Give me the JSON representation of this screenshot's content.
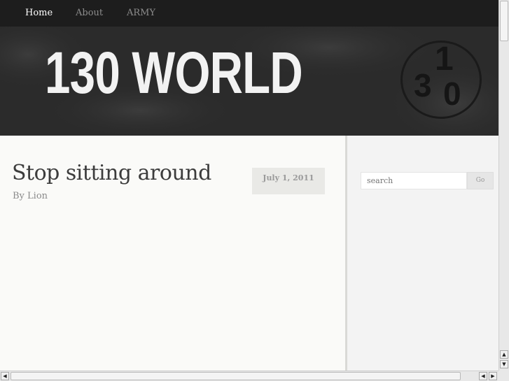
{
  "nav": {
    "items": [
      {
        "label": "Home",
        "active": true
      },
      {
        "label": "About",
        "active": false
      },
      {
        "label": "ARMY",
        "active": false
      }
    ]
  },
  "header": {
    "logo_text": "130 WORLD",
    "badge_digits": [
      "1",
      "3",
      "0"
    ]
  },
  "post": {
    "title": "Stop sitting around",
    "author": "By Lion",
    "date": "July 1, 2011"
  },
  "sidebar": {
    "search_placeholder": "search",
    "go_label": "Go"
  },
  "scrollbars": {
    "up_icon": "▲",
    "down_icon": "▼",
    "left_icon": "◀",
    "right_icon": "▶"
  },
  "colors": {
    "nav_bg": "#1d1d1d",
    "header_bg": "#2b2b2b",
    "page_bg": "#fafaf8",
    "title_text": "#3c3c3c"
  }
}
